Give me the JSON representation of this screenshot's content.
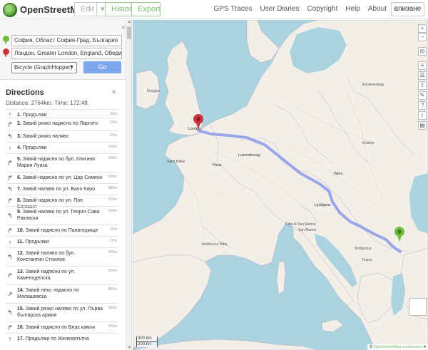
{
  "header": {
    "brand": "OpenStreetMap",
    "edit_label": "Edit",
    "history_label": "History",
    "export_label": "Export",
    "links": [
      "GPS Traces",
      "User Diaries",
      "Copyright",
      "Help",
      "About"
    ],
    "login_label": "влизане"
  },
  "route": {
    "from": "София, Област София-Град, България",
    "to": "Лондон, Greater London, England, Обедин",
    "engine": "Bicycle (GraphHopper)",
    "go_label": "Go"
  },
  "directions": {
    "title": "Directions",
    "stats": "Distance: 2764km. Time: 172:48.",
    "steps": [
      {
        "num": "1.",
        "text": "Продължи",
        "dist": "30m",
        "icon": "↑"
      },
      {
        "num": "2.",
        "text": "Завий рязко надясно по Ларгото",
        "dist": "30m",
        "icon": "↱"
      },
      {
        "num": "3.",
        "text": "Завий рязко наляво",
        "dist": "20m",
        "icon": "↰"
      },
      {
        "num": "4.",
        "text": "Продължи",
        "dist": "160m",
        "icon": "↑"
      },
      {
        "num": "5.",
        "text": "Завий надясно по бул. Княгиня Мария Луиза",
        "dist": "290m",
        "icon": "↱"
      },
      {
        "num": "6.",
        "text": "Завий надясно по ул. Цар Симеон",
        "dist": "500m",
        "icon": "↱"
      },
      {
        "num": "7.",
        "text": "Завий наляво по ул. Бачо Киро",
        "dist": "300m",
        "icon": "↰"
      },
      {
        "num": "8.",
        "text": "Завий надясно по ул. Поп Богомил",
        "dist": "150m",
        "icon": "↱"
      },
      {
        "num": "9.",
        "text": "Завий наляво по ул. Георги Сава Раковски",
        "dist": "150m",
        "icon": "↰"
      },
      {
        "num": "10.",
        "text": "Завий надясно по Панагюрище",
        "dist": "20m",
        "icon": "↱"
      },
      {
        "num": "11.",
        "text": "Продължи",
        "dist": "10m",
        "icon": "↑"
      },
      {
        "num": "12.",
        "text": "Завий наляво по бул. Константин Стоилов",
        "dist": "200m",
        "icon": "↰"
      },
      {
        "num": "13.",
        "text": "Завий надясно по ул. Каменоделска",
        "dist": "600m",
        "icon": "↱"
      },
      {
        "num": "14.",
        "text": "Завий леко надясно по Малашевска",
        "dist": "800m",
        "icon": "↗"
      },
      {
        "num": "15.",
        "text": "Завий рязко наляво по ул. Първа българска армия",
        "dist": "200m",
        "icon": "↰"
      },
      {
        "num": "16.",
        "text": "Завий надясно по Влах камък",
        "dist": "200m",
        "icon": "↱"
      },
      {
        "num": "17.",
        "text": "Продължи по Железопътна",
        "dist": "",
        "icon": "↑"
      }
    ]
  },
  "map": {
    "labels": [
      {
        "t": "Douglas",
        "c": false
      },
      {
        "t": "London",
        "c": true
      },
      {
        "t": "Luxembourg",
        "c": true
      },
      {
        "t": "Paris",
        "c": true
      },
      {
        "t": "Saint Helier",
        "c": false
      },
      {
        "t": "Wien",
        "c": true
      },
      {
        "t": "Ljubljana",
        "c": true
      },
      {
        "t": "San Marino",
        "c": false
      },
      {
        "t": "Andorra la Vella",
        "c": false
      },
      {
        "t": "Podgorica",
        "c": false
      },
      {
        "t": "Tirana",
        "c": false
      },
      {
        "t": "Калининград",
        "c": false
      },
      {
        "t": "Kraków",
        "c": false
      },
      {
        "t": "Città di San Marino",
        "c": false
      }
    ],
    "scale_km": "300 km",
    "scale_mi": "200 mi",
    "attribution_prefix": "© ",
    "attribution_link": "OpenStreetMap contributors",
    "zoom_in": "+",
    "zoom_out": "−",
    "colors": {
      "route": "#7d8eea",
      "land": "#f2efe9",
      "water": "#aad3df",
      "start_pin": "#6ec03a",
      "end_pin": "#c9373b"
    }
  }
}
